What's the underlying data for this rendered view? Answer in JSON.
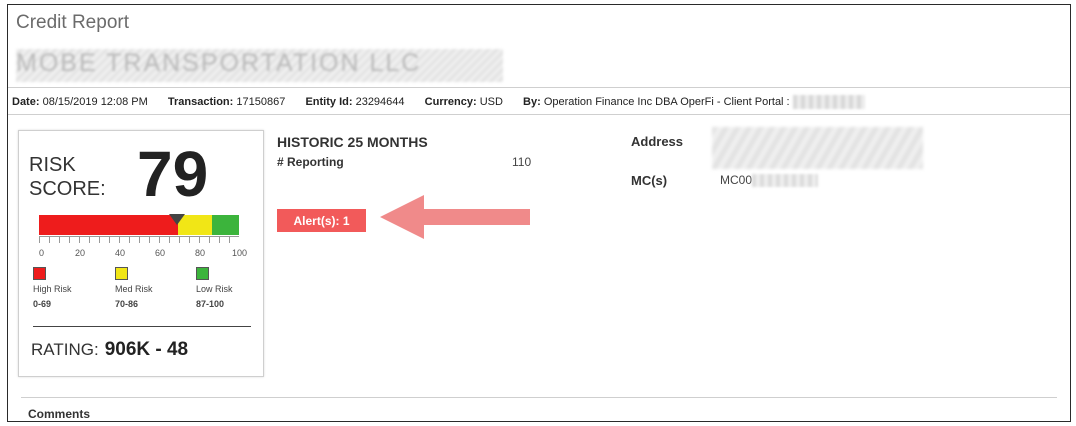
{
  "page": {
    "title": "Credit Report"
  },
  "company": {
    "name_redacted": "MOBE TRANSPORTATION LLC"
  },
  "meta": {
    "date_label": "Date:",
    "date_value": "08/15/2019 12:08 PM",
    "transaction_label": "Transaction:",
    "transaction_value": "17150867",
    "entity_label": "Entity Id:",
    "entity_value": "23294644",
    "currency_label": "Currency:",
    "currency_value": "USD",
    "by_label": "By:",
    "by_value": "Operation Finance Inc DBA OperFi - Client Portal :"
  },
  "score_card": {
    "risk_label": "RISK SCORE:",
    "score": "79",
    "ticks": [
      "0",
      "20",
      "40",
      "60",
      "80",
      "100"
    ],
    "legend": [
      {
        "label": "High Risk",
        "range": "0-69",
        "color": "#ee1c1c"
      },
      {
        "label": "Med Risk",
        "range": "70-86",
        "color": "#f1e616"
      },
      {
        "label": "Low Risk",
        "range": "87-100",
        "color": "#3cb43c"
      }
    ],
    "rating_label": "RATING:",
    "rating_value": "906K - 48"
  },
  "historic": {
    "title": "HISTORIC 25 MONTHS",
    "reporting_label": "# Reporting",
    "reporting_value": "110"
  },
  "alerts": {
    "label": "Alert(s): 1",
    "color": "#f25a5a"
  },
  "annotation": {
    "icon": "arrow-left-icon",
    "color": "#f08a8a"
  },
  "details": {
    "address_label": "Address",
    "mc_label": "MC(s)",
    "mc_value": "MC00"
  },
  "comments": {
    "label": "Comments"
  }
}
